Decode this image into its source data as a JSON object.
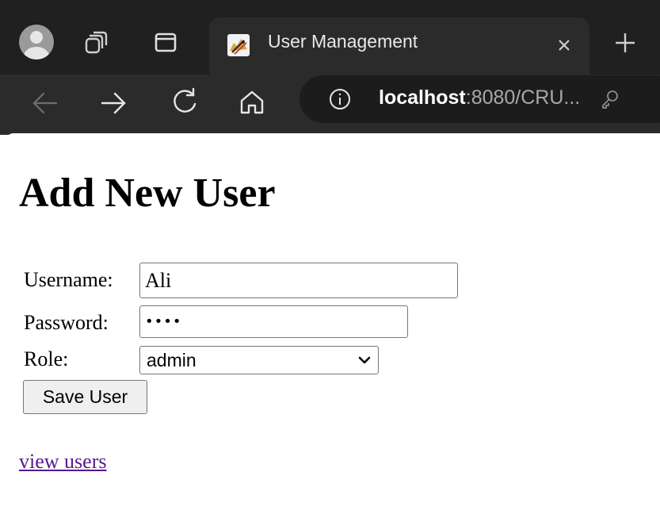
{
  "browser": {
    "tab": {
      "title": "User Management",
      "favicon": "tomcat-icon"
    },
    "address_bar": {
      "host": "localhost",
      "rest": ":8080/CRU..."
    },
    "icons": {
      "profile": "avatar-icon",
      "workspaces": "workspaces-icon",
      "tab_actions": "tab-actions-icon",
      "close": "close-icon",
      "new_tab": "plus-icon",
      "back": "back-arrow-icon",
      "forward": "forward-arrow-icon",
      "refresh": "refresh-icon",
      "home": "home-icon",
      "site_info": "info-icon",
      "password_key": "key-icon"
    },
    "colors": {
      "tabstrip": "#202020",
      "toolbar": "#2b2b2b",
      "address_bar": "#1c1c1c"
    }
  },
  "page": {
    "title": "Add New User",
    "form": {
      "username_label": "Username:",
      "username_value": "Ali",
      "password_label": "Password:",
      "password_value": "••••",
      "role_label": "Role:",
      "role_value": "admin",
      "save_label": "Save User"
    },
    "link": {
      "view_users": "view users",
      "color": "#551a8b"
    }
  }
}
